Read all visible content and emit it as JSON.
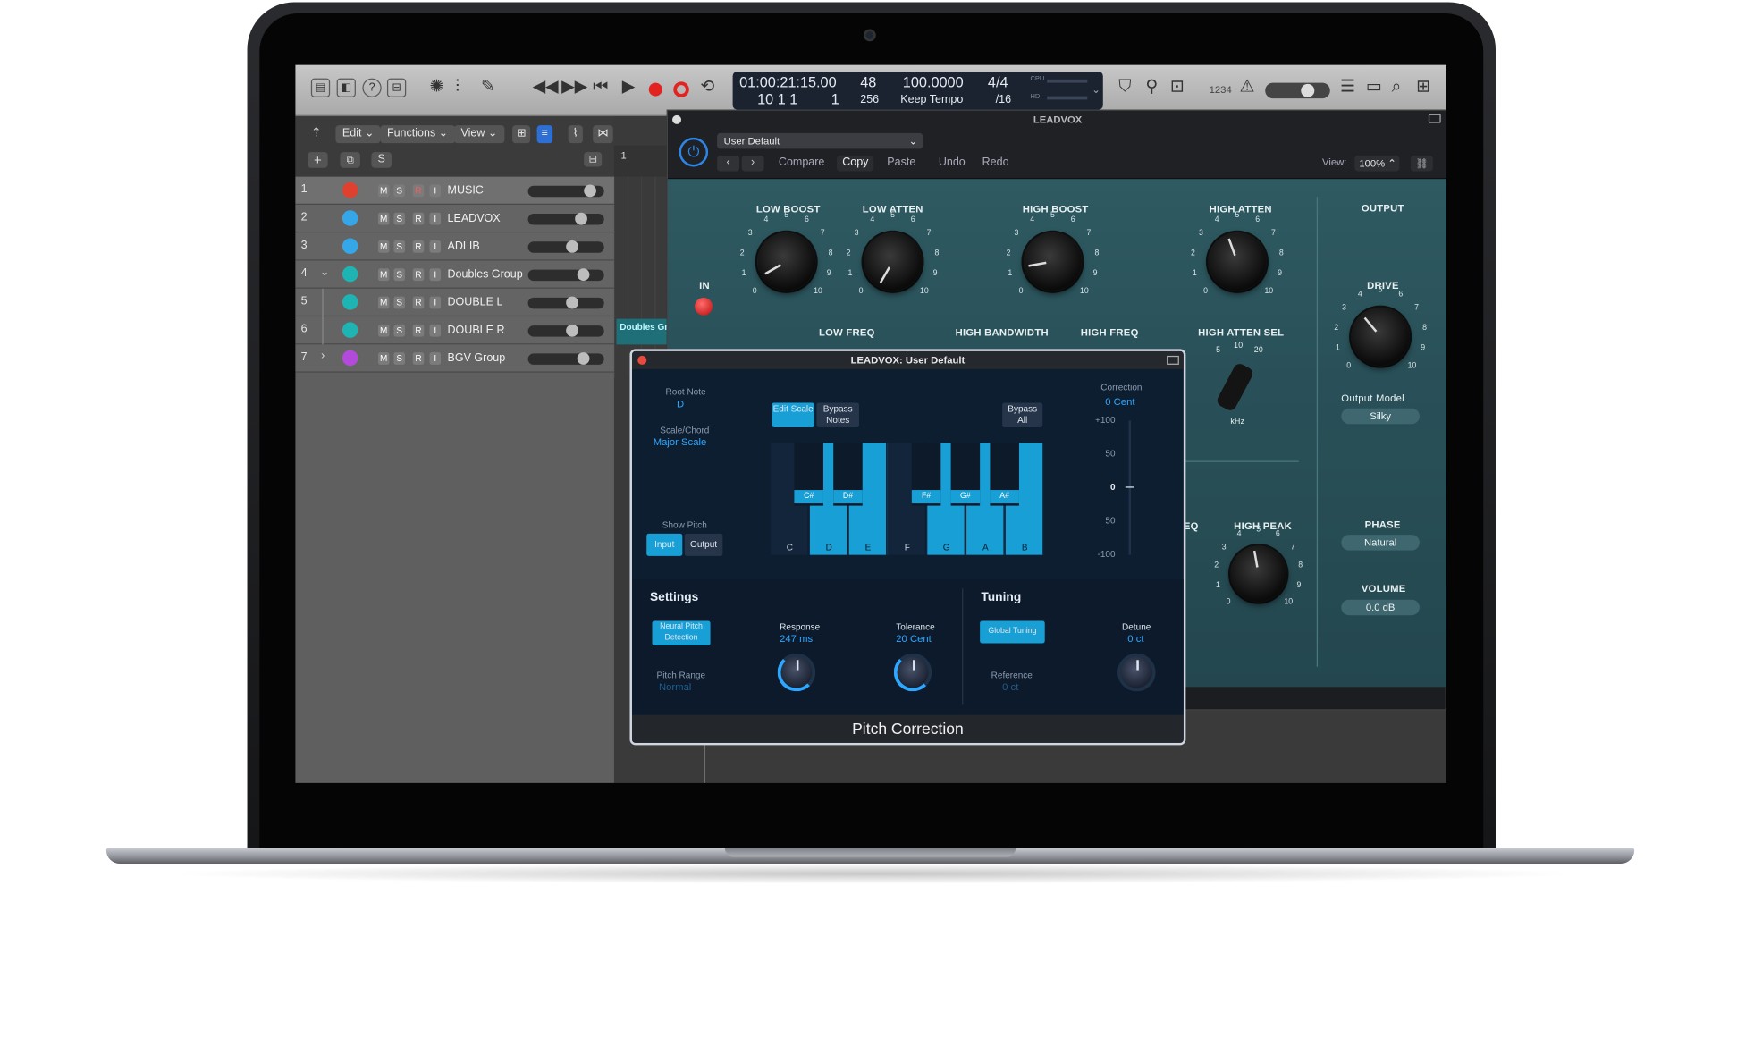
{
  "transport": {
    "position_smpte": "01:00:21:15.00",
    "position_bars": "10 1 1",
    "position_ticks": "1",
    "tempo_label": "48",
    "tempo_sub": "256",
    "bpm": "100.0000",
    "tempo_mode": "Keep Tempo",
    "signature": "4/4",
    "division": "/16",
    "cpu_label": "CPU",
    "hd_label": "HD",
    "count_label": "1234"
  },
  "tracks_header": {
    "edit": "Edit",
    "functions": "Functions",
    "view": "View",
    "s_button": "S",
    "ruler_start": "1"
  },
  "tracks": [
    {
      "num": "1",
      "name": "MUSIC",
      "color": "#e0412f",
      "rec": "R"
    },
    {
      "num": "2",
      "name": "LEADVOX",
      "color": "#35a6e8",
      "rec": "R"
    },
    {
      "num": "3",
      "name": "ADLIB",
      "color": "#35a6e8",
      "rec": "R"
    },
    {
      "num": "4",
      "name": "Doubles Group",
      "color": "#1fb4b4",
      "rec": "R"
    },
    {
      "num": "5",
      "name": "DOUBLE L",
      "color": "#1fb4b4",
      "rec": "R"
    },
    {
      "num": "6",
      "name": "DOUBLE R",
      "color": "#1fb4b4",
      "rec": "R"
    },
    {
      "num": "7",
      "name": "BGV Group",
      "color": "#b34adb",
      "rec": "R"
    }
  ],
  "region_label": "Doubles Gr",
  "plugin": {
    "title": "LEADVOX",
    "preset": "User Default",
    "compare": "Compare",
    "copy": "Copy",
    "paste": "Paste",
    "undo": "Undo",
    "redo": "Redo",
    "view_label": "View:",
    "view_value": "100%",
    "eq": {
      "low_boost": "LOW BOOST",
      "low_atten": "LOW ATTEN",
      "high_boost": "HIGH BOOST",
      "high_atten": "HIGH ATTEN",
      "output": "OUTPUT",
      "in": "IN",
      "low_freq": "LOW FREQ",
      "high_bandwidth": "HIGH BANDWIDTH",
      "high_freq": "HIGH FREQ",
      "high_atten_sel": "HIGH ATTEN SEL",
      "khz": "kHz",
      "drive": "DRIVE",
      "output_model": "Output Model",
      "output_model_value": "Silky",
      "phase": "PHASE",
      "phase_value": "Natural",
      "volume": "VOLUME",
      "volume_value": "0.0 dB",
      "high_peak": "HIGH PEAK",
      "eq_partial": "EQ",
      "sel_5": "5",
      "sel_10": "10",
      "sel_20": "20"
    }
  },
  "pitch": {
    "title": "LEADVOX: User Default",
    "root_note_label": "Root Note",
    "root_note": "D",
    "scale_label": "Scale/Chord",
    "scale": "Major Scale",
    "edit_scale": "Edit Scale",
    "bypass_notes": "Bypass Notes",
    "bypass_all": "Bypass All",
    "show_pitch": "Show Pitch",
    "input": "Input",
    "output": "Output",
    "correction_label": "Correction",
    "correction_value": "0 Cent",
    "meter": [
      "+100",
      "50",
      "0",
      "50",
      "-100"
    ],
    "white_keys": [
      "C",
      "D",
      "E",
      "F",
      "G",
      "A",
      "B"
    ],
    "black_keys": [
      "C#",
      "D#",
      "F#",
      "G#",
      "A#"
    ],
    "settings": "Settings",
    "neural": "Neural Pitch Detection",
    "response_label": "Response",
    "response_value": "247 ms",
    "tolerance_label": "Tolerance",
    "tolerance_value": "20 Cent",
    "pitch_range_label": "Pitch Range",
    "pitch_range_value": "Normal",
    "tuning": "Tuning",
    "global_tuning": "Global Tuning",
    "detune_label": "Detune",
    "detune_value": "0 ct",
    "reference_label": "Reference",
    "reference_value": "0 ct",
    "footer": "Pitch Correction"
  }
}
